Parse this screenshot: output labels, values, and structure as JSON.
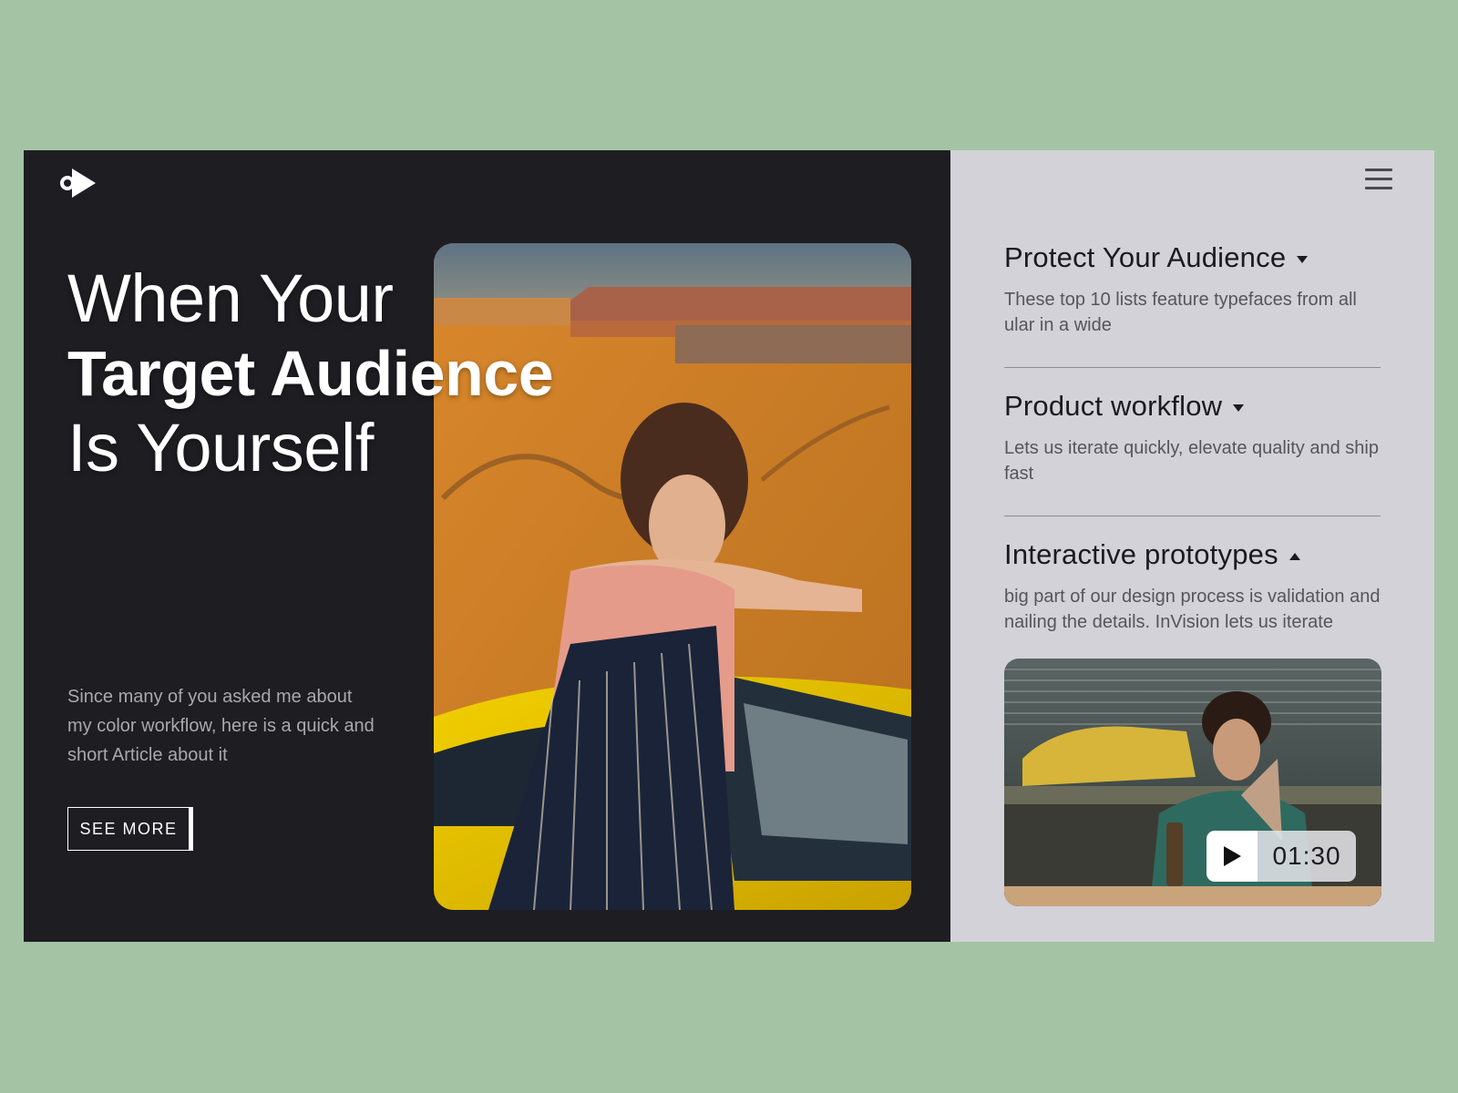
{
  "hero": {
    "headline_line1": "When Your",
    "headline_line2": "Target Audience",
    "headline_line3": "Is Yourself",
    "intro_text": "Since many of you asked me about my color workflow, here is a quick and short Article about it",
    "cta_label": "SEE MORE"
  },
  "sidebar": {
    "items": [
      {
        "title": "Protect Your Audience",
        "description": "These top 10 lists feature typefaces from all ular in a wide",
        "caret": "down"
      },
      {
        "title": "Product workflow",
        "description": "Lets us iterate quickly, elevate quality and ship fast",
        "caret": "down"
      },
      {
        "title": "Interactive prototypes",
        "description": "big part of our design process is validation and nailing the details. InVision lets us iterate",
        "caret": "up"
      }
    ],
    "video": {
      "duration": "01:30"
    }
  },
  "icons": {
    "logo": "play-logo-icon",
    "menu": "hamburger-menu-icon",
    "play": "play-icon",
    "caret_down": "caret-down-icon",
    "caret_up": "caret-up-icon"
  },
  "colors": {
    "page_background": "#a4c3a5",
    "dark_panel": "#1e1d22",
    "light_panel": "#d3d2d9",
    "text_primary": "#1b1b1f",
    "text_muted": "#56555b"
  }
}
